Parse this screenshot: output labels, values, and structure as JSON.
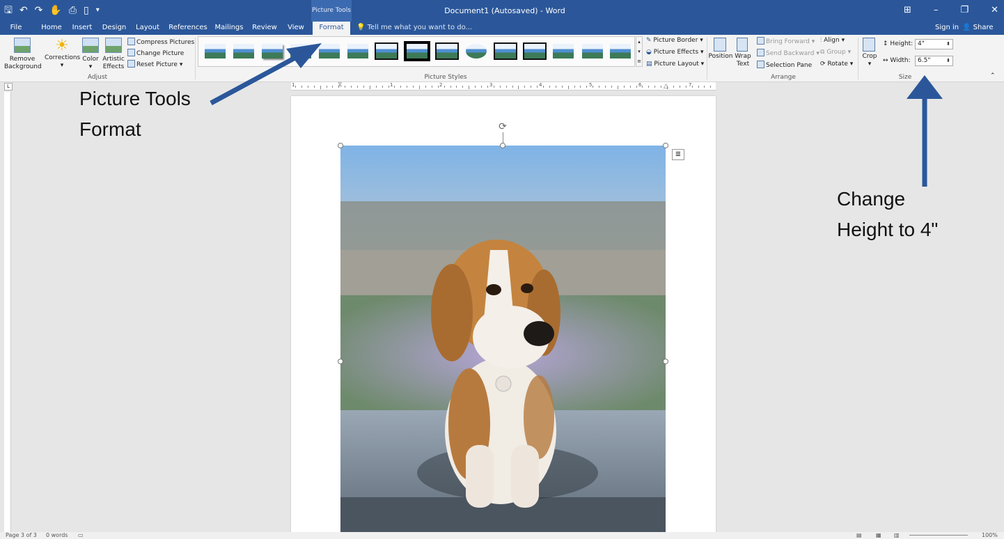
{
  "titlebar": {
    "quick_access_icons": [
      "save-icon",
      "undo-icon",
      "redo-icon",
      "touch-mode-icon",
      "print-preview-icon",
      "new-document-icon",
      "customize-qat-icon"
    ],
    "context_group": "Picture Tools",
    "document_title": "Document1 (Autosaved) - Word",
    "window_controls": [
      "ribbon-display-icon",
      "minimize-icon",
      "restore-icon",
      "close-icon"
    ]
  },
  "tabs": [
    "File",
    "Home",
    "Insert",
    "Design",
    "Layout",
    "References",
    "Mailings",
    "Review",
    "View",
    "Format"
  ],
  "active_tab": "Format",
  "tellme_placeholder": "Tell me what you want to do...",
  "signin": "Sign in",
  "share": "Share",
  "ribbon": {
    "adjust": {
      "label": "Adjust",
      "remove_background_1": "Remove",
      "remove_background_2": "Background",
      "corrections": "Corrections",
      "color": "Color",
      "artistic_1": "Artistic",
      "artistic_2": "Effects",
      "compress": "Compress Pictures",
      "change": "Change Picture",
      "reset": "Reset Picture"
    },
    "picture_styles": {
      "label": "Picture Styles",
      "border": "Picture Border",
      "effects": "Picture Effects",
      "layout": "Picture Layout"
    },
    "arrange": {
      "label": "Arrange",
      "position": "Position",
      "wrap_1": "Wrap",
      "wrap_2": "Text",
      "bring_forward": "Bring Forward",
      "send_backward": "Send Backward",
      "selection_pane": "Selection Pane",
      "align": "Align",
      "group": "Group",
      "rotate": "Rotate"
    },
    "size": {
      "label": "Size",
      "crop": "Crop",
      "height_label": "Height:",
      "height_value": "4\"",
      "width_label": "Width:",
      "width_value": "6.5\""
    }
  },
  "ruler_numbers": [
    "1",
    "1",
    "2",
    "3",
    "4",
    "5",
    "6",
    "7"
  ],
  "statusbar": {
    "page": "Page 3 of 3",
    "words": "0 words",
    "zoom": "100%"
  },
  "annotations": {
    "picture_tools_1": "Picture Tools",
    "picture_tools_2": "Format",
    "change_height_1": "Change",
    "change_height_2": "Height to 4\""
  },
  "colors": {
    "word_blue": "#2b579a",
    "arrow": "#2b579a"
  }
}
